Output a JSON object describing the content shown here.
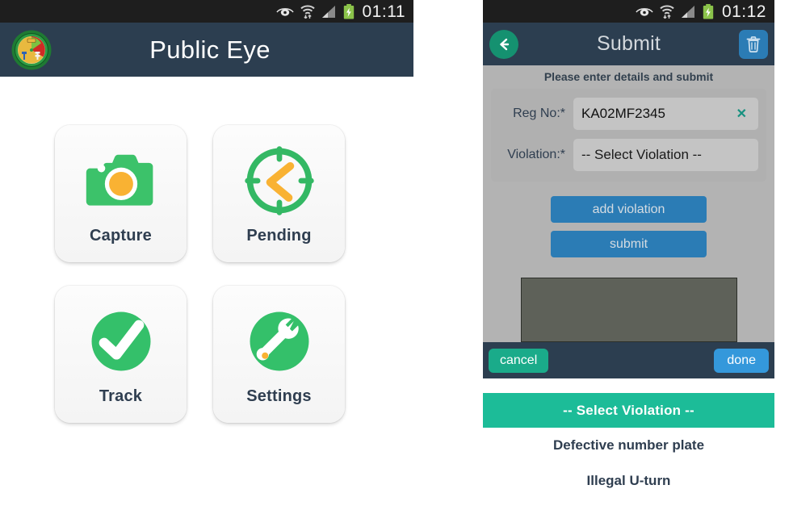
{
  "left_phone": {
    "statusbar": {
      "time": "01:11",
      "icons": [
        "eye-off-icon",
        "wifi-icon",
        "signal-icon",
        "battery-charging-icon"
      ]
    },
    "appbar": {
      "title": "Public Eye",
      "logo": "department-emblem-icon",
      "background": "#2c3e50"
    },
    "tiles": [
      {
        "label": "Capture",
        "icon": "camera-icon"
      },
      {
        "label": "Pending",
        "icon": "clock-icon"
      },
      {
        "label": "Track",
        "icon": "check-circle-icon"
      },
      {
        "label": "Settings",
        "icon": "wrench-circle-icon"
      }
    ]
  },
  "right_phone": {
    "statusbar": {
      "time": "01:12",
      "icons": [
        "eye-off-icon",
        "wifi-icon",
        "signal-icon",
        "battery-charging-icon"
      ]
    },
    "appbar": {
      "title": "Submit",
      "back_icon": "arrow-left-icon",
      "delete_icon": "trash-icon"
    },
    "hint": "Please enter details and submit",
    "form": {
      "reg_no": {
        "label": "Reg No:*",
        "value": "KA02MF2345",
        "clear_label": "✕"
      },
      "violation": {
        "label": "Violation:*",
        "value": "-- Select Violation --"
      }
    },
    "buttons": {
      "add_violation": "add violation",
      "submit": "submit"
    },
    "bottom_bar": {
      "cancel": "cancel",
      "done": "done"
    },
    "dropdown": {
      "header": "-- Select Violation --",
      "items": [
        "Defective number plate",
        "Illegal U-turn"
      ]
    },
    "colors": {
      "accent_teal": "#1cbc98",
      "button_blue": "#2b7cb5",
      "done_blue": "#3498db",
      "appbar": "#2c3e50"
    }
  }
}
